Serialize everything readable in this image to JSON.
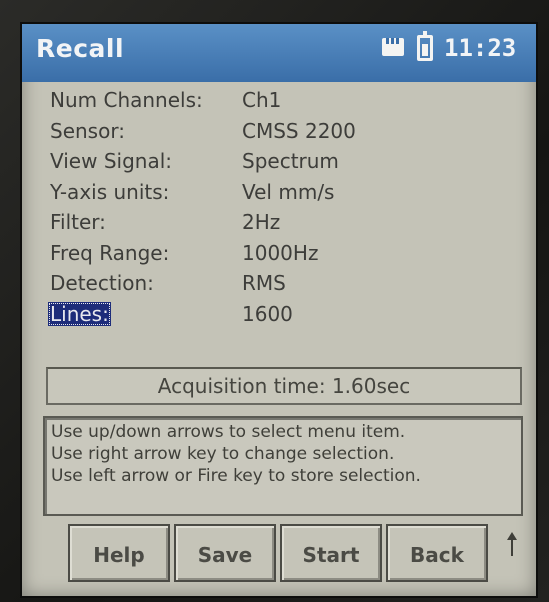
{
  "header": {
    "title": "Recall",
    "time": "11:23",
    "icons": [
      "sd-card-icon",
      "battery-icon"
    ],
    "color": "#4a80b8"
  },
  "settings": [
    {
      "label": "Num Channels:",
      "value": "Ch1"
    },
    {
      "label": "Sensor:",
      "value": "CMSS 2200"
    },
    {
      "label": "View Signal:",
      "value": "Spectrum"
    },
    {
      "label": "Y-axis units:",
      "value": "Vel mm/s"
    },
    {
      "label": "Filter:",
      "value": "2Hz"
    },
    {
      "label": "Freq Range:",
      "value": "1000Hz"
    },
    {
      "label": "Detection:",
      "value": "RMS"
    },
    {
      "label": "Lines:",
      "value": "1600",
      "selected": true
    }
  ],
  "acquisition": {
    "text": "Acquisition time: 1.60sec"
  },
  "help": {
    "lines": [
      "Use up/down arrows to select menu item.",
      "Use right arrow key to change selection.",
      "Use left arrow or Fire key to store selection."
    ]
  },
  "softkeys": [
    {
      "label": "Help"
    },
    {
      "label": "Save"
    },
    {
      "label": "Start"
    },
    {
      "label": "Back"
    }
  ],
  "colors": {
    "selection": "#1d2c7a",
    "screen": "#c4c3b7"
  }
}
